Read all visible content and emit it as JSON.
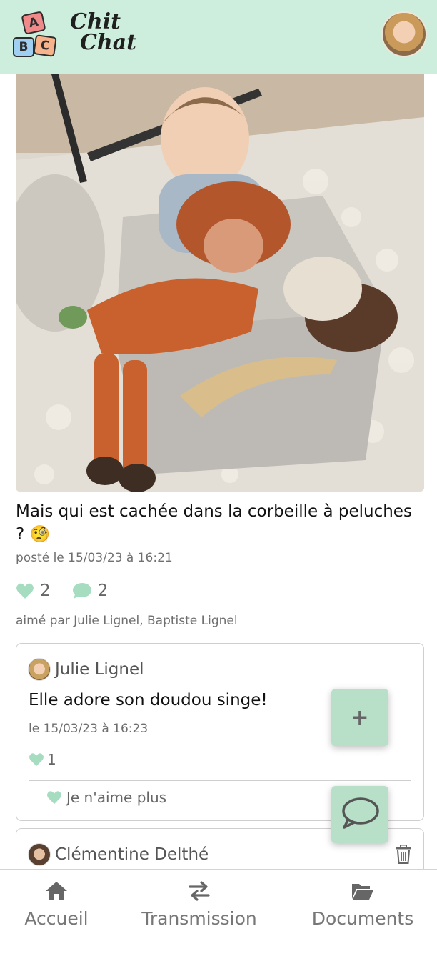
{
  "header": {
    "logo_blocks": [
      "A",
      "B",
      "C"
    ],
    "logo_line1": "Chit",
    "logo_line2": "Chat",
    "brand_bg": "#cdeedd"
  },
  "post": {
    "caption": "Mais qui est cachée dans la corbeille à peluches ? 🧐",
    "posted": "posté le 15/03/23 à 16:21",
    "likes_count": "2",
    "comments_count": "2",
    "liked_by": "aimé par Julie Lignel, Baptiste Lignel"
  },
  "comments": [
    {
      "author": "Julie Lignel",
      "text": "Elle adore son doudou singe!",
      "date": "le 15/03/23 à 16:23",
      "likes": "1",
      "unlike_label": "Je n'aime plus"
    },
    {
      "author": "Clémentine Delthé"
    }
  ],
  "fab": {
    "plus_label": "+"
  },
  "nav": {
    "home": "Accueil",
    "transmission": "Transmission",
    "documents": "Documents"
  },
  "colors": {
    "accent": "#b8e0c9",
    "icon_green": "#a6dcc0",
    "icon_gray": "#666666"
  }
}
